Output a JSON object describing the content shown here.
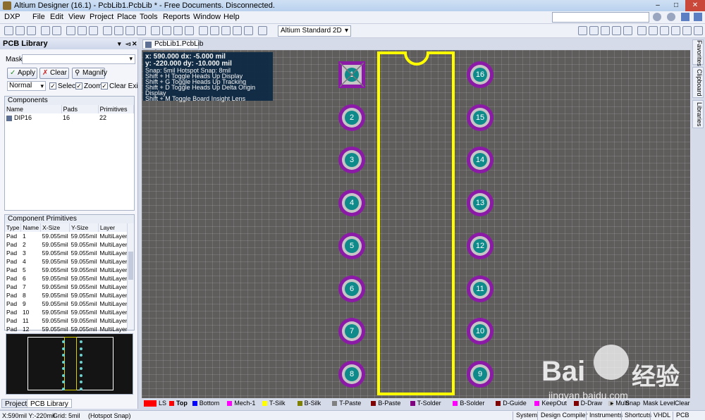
{
  "window": {
    "title": "Altium Designer (16.1) - PcbLib1.PcbLib * - Free Documents. Disconnected."
  },
  "menu": [
    "DXP",
    "File",
    "Edit",
    "View",
    "Project",
    "Place",
    "Tools",
    "Reports",
    "Window",
    "Help"
  ],
  "toolbar": {
    "view_mode": "Altium Standard 2D"
  },
  "panel": {
    "title": "PCB Library",
    "mask_label": "Mask",
    "apply": "Apply",
    "clear": "Clear",
    "magnify": "Magnify",
    "mode": "Normal",
    "select": "Select",
    "zoom": "Zoom",
    "clear_existing": "Clear Existing",
    "components_title": "Components",
    "components_cols": [
      "Name",
      "Pads",
      "Primitives"
    ],
    "components": [
      {
        "name": "DIP16",
        "pads": "16",
        "primitives": "22"
      }
    ],
    "primitives_title": "Component Primitives",
    "primitives_cols": [
      "Type",
      "Name",
      "X-Size",
      "Y-Size",
      "Layer"
    ],
    "primitives": [
      [
        "Pad",
        "1",
        "59.055mil",
        "59.055mil",
        "MultiLayer"
      ],
      [
        "Pad",
        "2",
        "59.055mil",
        "59.055mil",
        "MultiLayer"
      ],
      [
        "Pad",
        "3",
        "59.055mil",
        "59.055mil",
        "MultiLayer"
      ],
      [
        "Pad",
        "4",
        "59.055mil",
        "59.055mil",
        "MultiLayer"
      ],
      [
        "Pad",
        "5",
        "59.055mil",
        "59.055mil",
        "MultiLayer"
      ],
      [
        "Pad",
        "6",
        "59.055mil",
        "59.055mil",
        "MultiLayer"
      ],
      [
        "Pad",
        "7",
        "59.055mil",
        "59.055mil",
        "MultiLayer"
      ],
      [
        "Pad",
        "8",
        "59.055mil",
        "59.055mil",
        "MultiLayer"
      ],
      [
        "Pad",
        "9",
        "59.055mil",
        "59.055mil",
        "MultiLayer"
      ],
      [
        "Pad",
        "10",
        "59.055mil",
        "59.055mil",
        "MultiLayer"
      ],
      [
        "Pad",
        "11",
        "59.055mil",
        "59.055mil",
        "MultiLayer"
      ],
      [
        "Pad",
        "12",
        "59.055mil",
        "59.055mil",
        "MultiLayer"
      ]
    ],
    "tabs": [
      "Projects",
      "PCB Library"
    ]
  },
  "doc": {
    "tab": "PcbLib1.PcbLib *"
  },
  "hud": {
    "line1": "x:  590.000   dx:    -5.000  mil",
    "line2": "y: -220.000   dy:   -10.000  mil",
    "line3": "Snap: 5mil Hotspot Snap: 8mil",
    "line4": "Shift + H  Toggle Heads Up Display",
    "line5": "Shift + G  Toggle Heads Up Tracking",
    "line6": "Shift + D  Toggle Heads Up Delta Origin Display",
    "line7": "Shift + M  Toggle Board Insight Lens"
  },
  "pads_left": [
    "1",
    "2",
    "3",
    "4",
    "5",
    "6",
    "7",
    "8"
  ],
  "pads_right": [
    "16",
    "15",
    "14",
    "13",
    "12",
    "11",
    "10",
    "9"
  ],
  "right_tabs": [
    "Favorites",
    "Clipboard",
    "Libraries"
  ],
  "layers": [
    {
      "name": "LS",
      "color": "#ff0000"
    },
    {
      "name": "Top",
      "color": "#ff0000"
    },
    {
      "name": "Bottom",
      "color": "#0000ff"
    },
    {
      "name": "Mech-1",
      "color": "#ff00ff"
    },
    {
      "name": "T-Silk",
      "color": "#ffff00"
    },
    {
      "name": "B-Silk",
      "color": "#808000"
    },
    {
      "name": "T-Paste",
      "color": "#808080"
    },
    {
      "name": "B-Paste",
      "color": "#800000"
    },
    {
      "name": "T-Solder",
      "color": "#800080"
    },
    {
      "name": "B-Solder",
      "color": "#ff00ff"
    },
    {
      "name": "D-Guide",
      "color": "#800000"
    },
    {
      "name": "KeepOut",
      "color": "#ff00ff"
    },
    {
      "name": "D-Draw",
      "color": "#800000"
    },
    {
      "name": "Multi",
      "color": "#c0c0c0"
    }
  ],
  "layer_right": [
    "Snap",
    "Mask Level",
    "Clear"
  ],
  "status": {
    "coords": "X:590mil Y:-220mil",
    "grid": "Grid: 5mil",
    "snap": "(Hotspot Snap)",
    "panels": [
      "System",
      "Design Compiler",
      "Instruments",
      "Shortcuts",
      "VHDL",
      "PCB"
    ]
  },
  "watermark": {
    "text": "Bai",
    "text2": "经验",
    "url": "jingyan.baidu.com"
  }
}
